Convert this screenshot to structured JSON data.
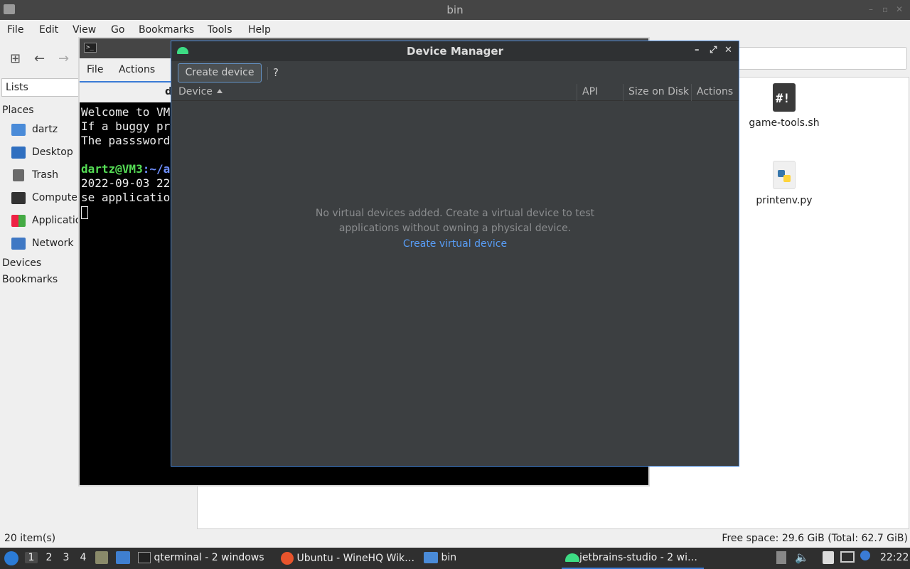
{
  "file_manager": {
    "title": "bin",
    "menu": [
      "File",
      "Edit",
      "View",
      "Go",
      "Bookmarks",
      "Tools",
      "Help"
    ],
    "side_pane_mode": "Lists",
    "places_header": "Places",
    "places": [
      {
        "label": "dartz",
        "icon": "home-icon"
      },
      {
        "label": "Desktop",
        "icon": "desktop-icon"
      },
      {
        "label": "Trash",
        "icon": "trash-icon"
      },
      {
        "label": "Computer",
        "icon": "computer-icon"
      },
      {
        "label": "Applications",
        "icon": "applications-icon"
      },
      {
        "label": "Network",
        "icon": "network-icon"
      }
    ],
    "devices_header": "Devices",
    "bookmarks_header": "Bookmarks",
    "files": [
      {
        "name": "game-tools.sh",
        "icon": "shell-script-icon"
      },
      {
        "name": "printenv.py",
        "icon": "python-file-icon"
      }
    ],
    "status_left": "20 item(s)",
    "status_right": "Free space: 29.6 GiB (Total: 62.7 GiB)"
  },
  "terminal": {
    "menu": [
      "File",
      "Actions"
    ],
    "tab_label": "d",
    "lines": [
      "Welcome to VM",
      "If a buggy pr",
      "The passsword",
      "",
      "",
      "2022-09-03 22",
      "se applicatio"
    ],
    "prompt_user": "dartz@VM3",
    "prompt_path": ":~/a"
  },
  "device_manager": {
    "title": "Device Manager",
    "create_button": "Create device",
    "help_button": "?",
    "columns": [
      "Device",
      "API",
      "Size on Disk",
      "Actions"
    ],
    "empty_line1": "No virtual devices added. Create a virtual device to test",
    "empty_line2": "applications without owning a physical device.",
    "create_link": "Create virtual device",
    "window_buttons": [
      "–",
      "⤢",
      "✕"
    ]
  },
  "taskbar": {
    "workspaces": [
      "1",
      "2",
      "3",
      "4"
    ],
    "active_workspace": "1",
    "tasks": [
      {
        "label": "qterminal - 2 windows",
        "icon": "terminal-icon"
      },
      {
        "label": "Ubuntu - WineHQ Wik…",
        "icon": "firefox-icon"
      },
      {
        "label": "bin",
        "icon": "folder-icon"
      },
      {
        "label": "jetbrains-studio - 2 wi…",
        "icon": "android-icon"
      }
    ],
    "clock": "22:22"
  },
  "colors": {
    "accent": "#3a7bd5",
    "dm_bg": "#3c3f41",
    "link": "#589df6",
    "android_green": "#3ddc84",
    "prompt_green": "#55dd55"
  }
}
